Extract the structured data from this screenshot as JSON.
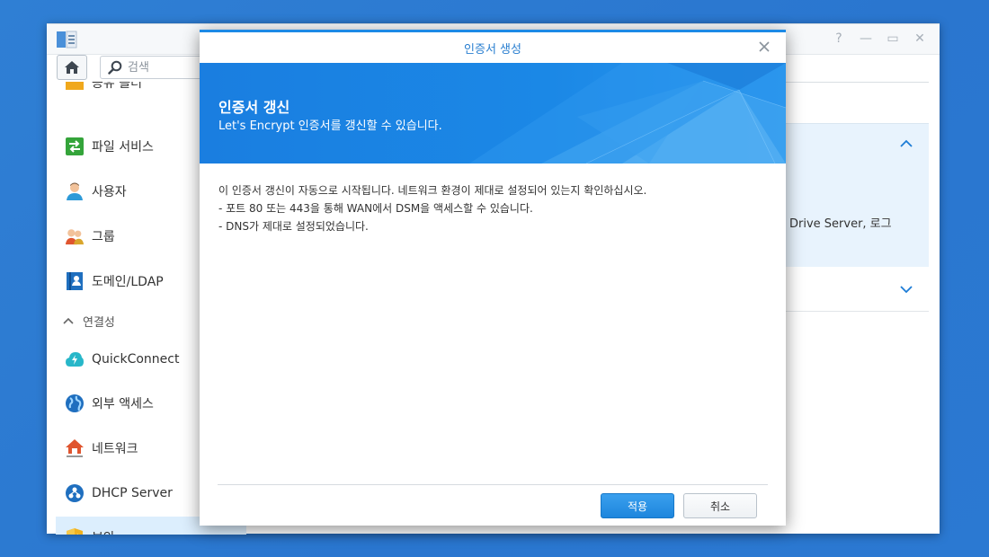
{
  "search": {
    "placeholder": "검색"
  },
  "sidebar": {
    "items": [
      {
        "label": "공유 폴더",
        "icon": "shared-folder-icon"
      },
      {
        "label": "파일 서비스",
        "icon": "file-services-icon"
      },
      {
        "label": "사용자",
        "icon": "user-icon"
      },
      {
        "label": "그룹",
        "icon": "group-icon"
      },
      {
        "label": "도메인/LDAP",
        "icon": "domain-ldap-icon"
      },
      {
        "label": "QuickConnect",
        "icon": "quickconnect-icon"
      },
      {
        "label": "외부 액세스",
        "icon": "external-access-icon"
      },
      {
        "label": "네트워크",
        "icon": "network-icon"
      },
      {
        "label": "DHCP Server",
        "icon": "dhcp-server-icon"
      },
      {
        "label": "보안",
        "icon": "security-shield-icon"
      }
    ],
    "section_label": "연결성"
  },
  "right_panel": {
    "peek_text": "Drive Server, 로그"
  },
  "dialog": {
    "title": "인증서 생성",
    "banner_title": "인증서 갱신",
    "banner_subtitle": "Let's Encrypt 인증서를 갱신할 수 있습니다.",
    "body_lines": [
      "이 인증서 갱신이 자동으로 시작됩니다. 네트워크 환경이 제대로 설정되어 있는지 확인하십시오.",
      "- 포트 80 또는 443을 통해 WAN에서 DSM을 액세스할 수 있습니다.",
      "- DNS가 제대로 설정되었습니다."
    ],
    "apply_label": "적용",
    "cancel_label": "취소"
  },
  "colors": {
    "accent": "#1d8ae6",
    "desktop": "#2f7fd4",
    "active_row": "#dceefd"
  }
}
